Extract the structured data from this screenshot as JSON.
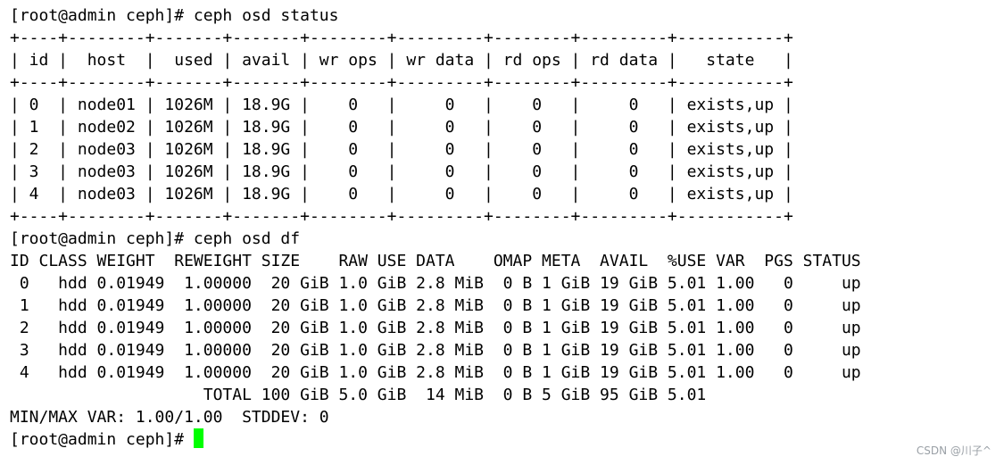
{
  "terminal": {
    "lines": [
      "[root@admin ceph]# ceph osd status",
      "+----+--------+-------+-------+--------+---------+--------+---------+-----------+",
      "| id |  host  |  used | avail | wr ops | wr data | rd ops | rd data |   state   |",
      "+----+--------+-------+-------+--------+---------+--------+---------+-----------+",
      "| 0  | node01 | 1026M | 18.9G |    0   |     0   |    0   |     0   | exists,up |",
      "| 1  | node02 | 1026M | 18.9G |    0   |     0   |    0   |     0   | exists,up |",
      "| 2  | node03 | 1026M | 18.9G |    0   |     0   |    0   |     0   | exists,up |",
      "| 3  | node03 | 1026M | 18.9G |    0   |     0   |    0   |     0   | exists,up |",
      "| 4  | node03 | 1026M | 18.9G |    0   |     0   |    0   |     0   | exists,up |",
      "+----+--------+-------+-------+--------+---------+--------+---------+-----------+",
      "[root@admin ceph]# ceph osd df",
      "ID CLASS WEIGHT  REWEIGHT SIZE    RAW USE DATA    OMAP META  AVAIL  %USE VAR  PGS STATUS",
      " 0   hdd 0.01949  1.00000  20 GiB 1.0 GiB 2.8 MiB  0 B 1 GiB 19 GiB 5.01 1.00   0     up",
      " 1   hdd 0.01949  1.00000  20 GiB 1.0 GiB 2.8 MiB  0 B 1 GiB 19 GiB 5.01 1.00   0     up",
      " 2   hdd 0.01949  1.00000  20 GiB 1.0 GiB 2.8 MiB  0 B 1 GiB 19 GiB 5.01 1.00   0     up",
      " 3   hdd 0.01949  1.00000  20 GiB 1.0 GiB 2.8 MiB  0 B 1 GiB 19 GiB 5.01 1.00   0     up",
      " 4   hdd 0.01949  1.00000  20 GiB 1.0 GiB 2.8 MiB  0 B 1 GiB 19 GiB 5.01 1.00   0     up",
      "                    TOTAL 100 GiB 5.0 GiB  14 MiB  0 B 5 GiB 95 GiB 5.01",
      "MIN/MAX VAR: 1.00/1.00  STDDEV: 0"
    ],
    "prompt": "[root@admin ceph]#",
    "cursor_color": "#00ff00"
  },
  "watermark": "CSDN @川子^"
}
